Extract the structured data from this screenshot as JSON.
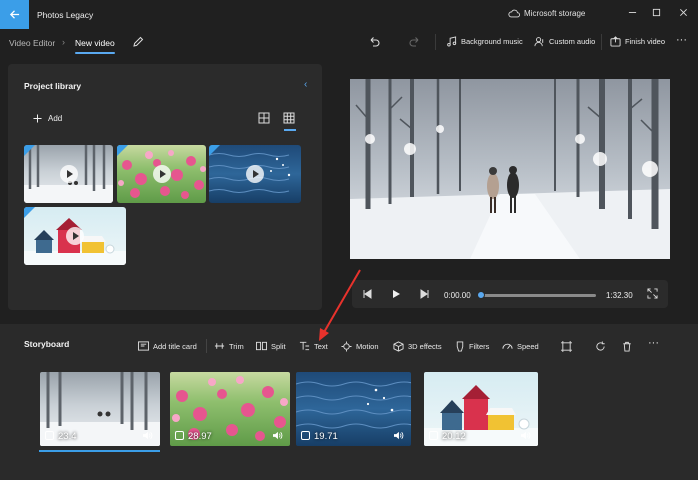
{
  "titlebar": {
    "app_title": "Photos Legacy",
    "storage_label": "Microsoft storage"
  },
  "nav": {
    "breadcrumb_parent": "Video Editor",
    "breadcrumb_current": "New video",
    "separator": "›"
  },
  "toolbar": {
    "background_music": "Background music",
    "custom_audio": "Custom audio",
    "finish_video": "Finish video",
    "more": "···"
  },
  "library": {
    "title": "Project library",
    "add_label": "Add"
  },
  "player": {
    "current_time": "0:00.00",
    "total_time": "1:32.30",
    "progress": 0.0
  },
  "storyboard": {
    "title": "Storyboard",
    "tools": {
      "add_title_card": "Add title card",
      "trim": "Trim",
      "split": "Split",
      "text": "Text",
      "motion": "Motion",
      "effects_3d": "3D effects",
      "filters": "Filters",
      "speed": "Speed"
    },
    "clips": [
      {
        "duration": "23.4"
      },
      {
        "duration": "28.97"
      },
      {
        "duration": "19.71"
      },
      {
        "duration": "20.12"
      }
    ]
  },
  "colors": {
    "accent": "#3b9ee8",
    "annotation": "#e8322c",
    "background": "#202020",
    "panel": "#2b2b2b"
  }
}
